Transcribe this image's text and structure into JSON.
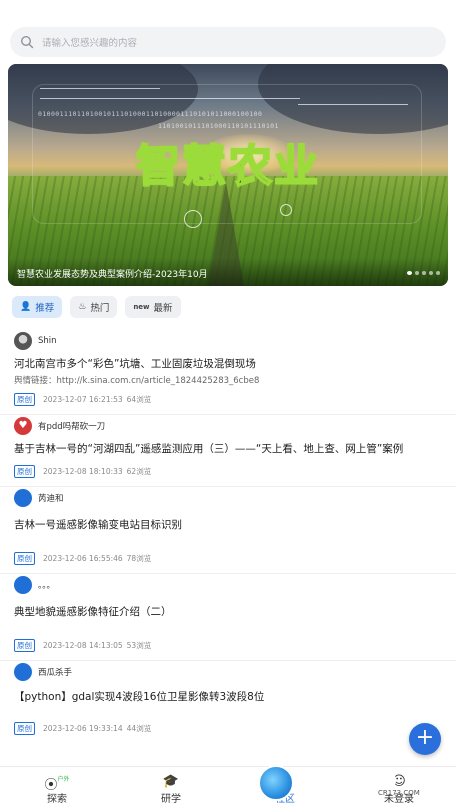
{
  "search": {
    "placeholder": "请输入您感兴趣的内容",
    "icon": "search-icon"
  },
  "banner": {
    "title": "智慧农业",
    "binary": "0100011101101001011101000110100001110101011000100100",
    "binary2": "1101001011101000110101110101",
    "caption": "智慧农业发展态势及典型案例介绍-2023年10月",
    "slides": 5,
    "active_slide": 1
  },
  "tabs": [
    {
      "label": "推荐",
      "icon": "user-icon",
      "active": true
    },
    {
      "label": "热门",
      "icon": "flame-icon",
      "active": false
    },
    {
      "label": "最新",
      "icon": "new-icon",
      "active": false
    }
  ],
  "feed": [
    {
      "author": "Shin",
      "title": "河北南宫市多个“彩色”坑塘、工业固废垃圾混倒现场",
      "link": "舆情链接：http://k.sina.com.cn/article_1824425283_6cbe8",
      "badge": "原创",
      "time": "2023-12-07 16:21:53",
      "views": "64浏览"
    },
    {
      "author": "有pdd吗帮砍一刀",
      "title": "基于吉林一号的“河湖四乱”遥感监测应用（三）——“天上看、地上查、网上管”案例",
      "badge": "原创",
      "time": "2023-12-08 18:10:33",
      "views": "62浏览"
    },
    {
      "author": "芮迪和",
      "title": "吉林一号遥感影像输变电站目标识别",
      "badge": "原创",
      "time": "2023-12-06 16:55:46",
      "views": "78浏览"
    },
    {
      "author": "。。。",
      "title": "典型地貌遥感影像特征介绍（二）",
      "badge": "原创",
      "time": "2023-12-08 14:13:05",
      "views": "53浏览"
    },
    {
      "author": "西瓜杀手",
      "title": "【python】gdal实现4波段16位卫星影像转3波段8位",
      "badge": "原创",
      "time": "2023-12-06 19:33:14",
      "views": "44浏览"
    }
  ],
  "fab": {
    "label": "+"
  },
  "nav": [
    {
      "label": "探索",
      "badge": "户外",
      "active": false
    },
    {
      "label": "研学",
      "active": false
    },
    {
      "label": "社区",
      "active": true
    },
    {
      "label": "未登录",
      "active": false
    }
  ],
  "watermark": {
    "brand": "西西软件园",
    "url": "CR173.COM"
  },
  "colors": {
    "accent": "#2a6fdb",
    "banner_text": "#9cdc3a"
  }
}
